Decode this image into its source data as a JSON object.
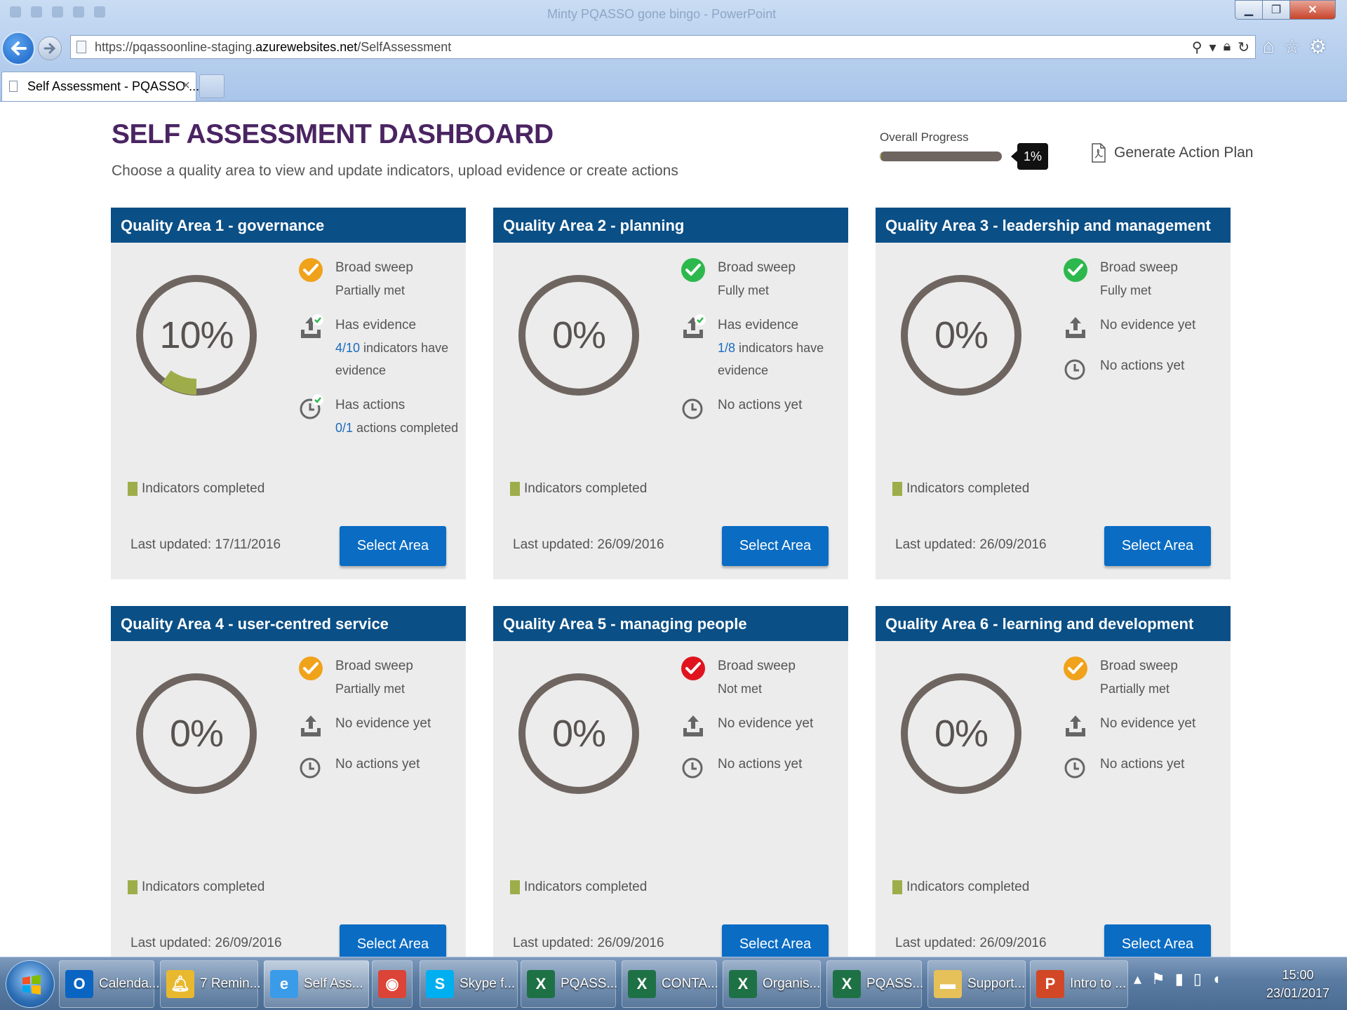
{
  "browser": {
    "window_title": "Minty PQASSO gone bingo - PowerPoint",
    "url_prefix": "https://pqassoonline-staging.",
    "url_host": "azurewebsites.net",
    "url_path": "/SelfAssessment",
    "tab_title": "Self Assessment - PQASSO ...",
    "tab_close": "×"
  },
  "page": {
    "title": "SELF ASSESSMENT DASHBOARD",
    "subtitle": "Choose a quality area to view and update indicators, upload evidence or create actions",
    "overall_progress_label": "Overall Progress",
    "overall_progress_text": "1%",
    "overall_progress_value": 0.01,
    "action_plan_label": "Generate Action Plan"
  },
  "colors": {
    "header": "#0a4f86",
    "button": "#0a6cc3",
    "title": "#4a2462",
    "gauge_ring": "#6f6560",
    "gauge_fill": "#9ead4a",
    "status_orange": "#f0a21b",
    "status_green": "#2db84d",
    "status_red": "#e0141e"
  },
  "cards": [
    {
      "title": "Quality Area 1 - governance",
      "percent_text": "10%",
      "percent_value": 0.1,
      "broad_sweep": {
        "label": "Broad sweep",
        "status": "Partially met",
        "icon": "check-orange"
      },
      "evidence": {
        "label": "Has evidence",
        "count": "4/10",
        "rest": " indicators have evidence",
        "icon": "upload-check-icon"
      },
      "actions": {
        "label": "Has actions",
        "count": "0/1",
        "rest": " actions completed",
        "icon": "clock-check-icon"
      },
      "legend": "Indicators completed",
      "last_updated": "Last updated: 17/11/2016",
      "button": "Select Area"
    },
    {
      "title": "Quality Area 2 - planning",
      "percent_text": "0%",
      "percent_value": 0,
      "broad_sweep": {
        "label": "Broad sweep",
        "status": "Fully met",
        "icon": "check-green"
      },
      "evidence": {
        "label": "Has evidence",
        "count": "1/8",
        "rest": " indicators have evidence",
        "icon": "upload-check-icon"
      },
      "actions": {
        "label": "No actions yet",
        "icon": "clock-icon"
      },
      "legend": "Indicators completed",
      "last_updated": "Last updated: 26/09/2016",
      "button": "Select Area"
    },
    {
      "title": "Quality Area 3 - leadership and management",
      "percent_text": "0%",
      "percent_value": 0,
      "broad_sweep": {
        "label": "Broad sweep",
        "status": "Fully met",
        "icon": "check-green"
      },
      "evidence": {
        "label": "No evidence yet",
        "icon": "upload-icon"
      },
      "actions": {
        "label": "No actions yet",
        "icon": "clock-icon"
      },
      "legend": "Indicators completed",
      "last_updated": "Last updated: 26/09/2016",
      "button": "Select Area"
    },
    {
      "title": "Quality Area 4 - user-centred service",
      "percent_text": "0%",
      "percent_value": 0,
      "broad_sweep": {
        "label": "Broad sweep",
        "status": "Partially met",
        "icon": "check-orange"
      },
      "evidence": {
        "label": "No evidence yet",
        "icon": "upload-icon"
      },
      "actions": {
        "label": "No actions yet",
        "icon": "clock-icon"
      },
      "legend": "Indicators completed",
      "last_updated": "Last updated: 26/09/2016",
      "button": "Select Area"
    },
    {
      "title": "Quality Area 5 - managing people",
      "percent_text": "0%",
      "percent_value": 0,
      "broad_sweep": {
        "label": "Broad sweep",
        "status": "Not met",
        "icon": "check-red"
      },
      "evidence": {
        "label": "No evidence yet",
        "icon": "upload-icon"
      },
      "actions": {
        "label": "No actions yet",
        "icon": "clock-icon"
      },
      "legend": "Indicators completed",
      "last_updated": "Last updated: 26/09/2016",
      "button": "Select Area"
    },
    {
      "title": "Quality Area 6 - learning and development",
      "percent_text": "0%",
      "percent_value": 0,
      "broad_sweep": {
        "label": "Broad sweep",
        "status": "Partially met",
        "icon": "check-orange"
      },
      "evidence": {
        "label": "No evidence yet",
        "icon": "upload-icon"
      },
      "actions": {
        "label": "No actions yet",
        "icon": "clock-icon"
      },
      "legend": "Indicators completed",
      "last_updated": "Last updated: 26/09/2016",
      "button": "Select Area"
    }
  ],
  "taskbar": {
    "items": [
      {
        "label": "Calenda...",
        "icon": "outlook-icon"
      },
      {
        "label": "7 Remin...",
        "icon": "bell-icon"
      },
      {
        "label": "Self Ass...",
        "icon": "internet-explorer-icon"
      },
      {
        "label": "",
        "icon": "chrome-icon"
      },
      {
        "label": "Skype f...",
        "icon": "skype-icon"
      },
      {
        "label": "PQASS...",
        "icon": "excel-icon"
      },
      {
        "label": "CONTA...",
        "icon": "excel-icon"
      },
      {
        "label": "Organis...",
        "icon": "excel-icon"
      },
      {
        "label": "PQASS...",
        "icon": "excel-icon"
      },
      {
        "label": "Support...",
        "icon": "folder-icon"
      },
      {
        "label": "Intro to ...",
        "icon": "powerpoint-icon"
      }
    ],
    "time": "15:00",
    "date": "23/01/2017"
  }
}
